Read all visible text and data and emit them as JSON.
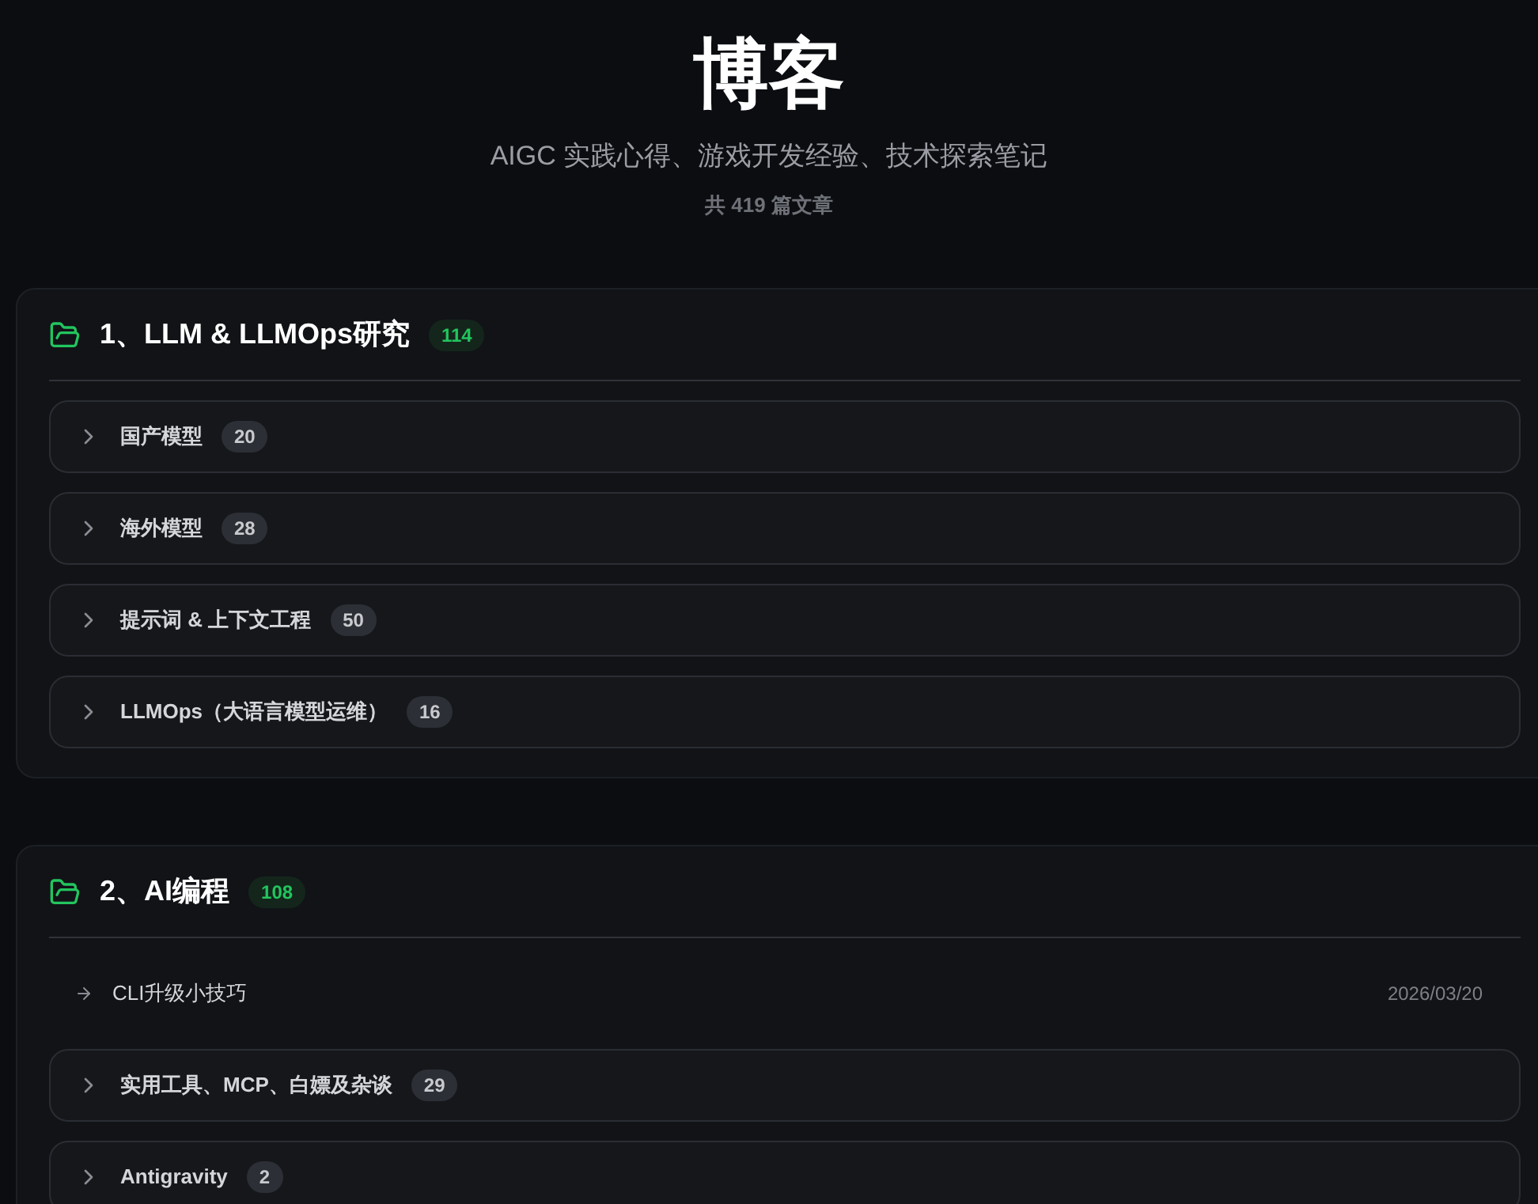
{
  "header": {
    "title": "博客",
    "subtitle": "AIGC 实践心得、游戏开发经验、技术探索笔记",
    "count": "共 419 篇文章"
  },
  "sections": [
    {
      "title": "1、LLM & LLMOps研究",
      "count": "114",
      "items": [
        {
          "kind": "category",
          "label": "国产模型",
          "count": "20"
        },
        {
          "kind": "category",
          "label": "海外模型",
          "count": "28"
        },
        {
          "kind": "category",
          "label": "提示词 & 上下文工程",
          "count": "50"
        },
        {
          "kind": "category",
          "label": "LLMOps（大语言模型运维）",
          "count": "16"
        }
      ]
    },
    {
      "title": "2、AI编程",
      "count": "108",
      "items": [
        {
          "kind": "post",
          "label": "CLI升级小技巧",
          "date": "2026/03/20"
        },
        {
          "kind": "category",
          "label": "实用工具、MCP、白嫖及杂谈",
          "count": "29"
        },
        {
          "kind": "category",
          "label": "Antigravity",
          "count": "2"
        }
      ]
    }
  ]
}
